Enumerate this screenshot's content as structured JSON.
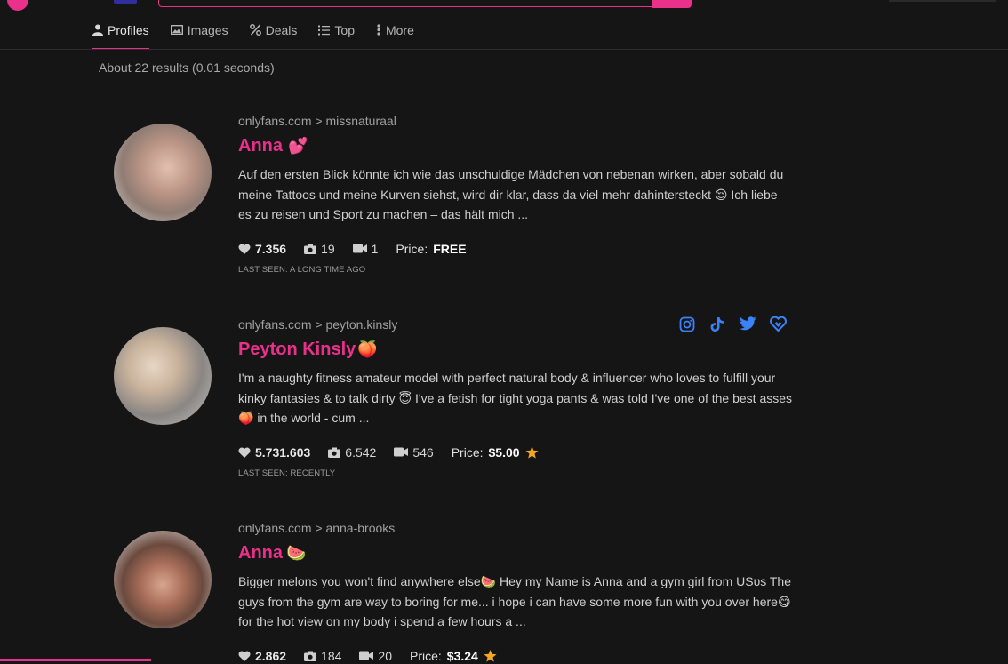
{
  "tabs": [
    {
      "label": "Profiles",
      "icon": "person-icon",
      "active": true
    },
    {
      "label": "Images",
      "icon": "image-icon"
    },
    {
      "label": "Deals",
      "icon": "percent-icon"
    },
    {
      "label": "Top",
      "icon": "list-icon"
    },
    {
      "label": "More",
      "icon": "vertical-dots-icon"
    }
  ],
  "results_info": "About 22 results (0.01 seconds)",
  "results": [
    {
      "breadcrumb": "onlyfans.com > missnaturaal",
      "name": "Anna",
      "name_emoji": "💕",
      "description": "Auf den ersten Blick könnte ich wie das unschuldige Mädchen von nebenan wirken, aber sobald du meine Tattoos und meine Kurven siehst, wird dir klar, dass da viel mehr dahintersteckt 😌 Ich liebe es zu reisen und Sport zu machen – das hält mich ...",
      "likes": "7.356",
      "photos": "19",
      "videos": "1",
      "price_label": "Price:",
      "price": "FREE",
      "last_seen": "LAST SEEN: A LONG TIME AGO"
    },
    {
      "breadcrumb": "onlyfans.com > peyton.kinsly",
      "name": "Peyton Kinsly",
      "name_emoji": "🍑",
      "description": "I'm a naughty fitness amateur model with perfect natural body & influencer who loves to fulfill your kinky fantasies & to talk dirty 😇 I've a fetish for tight yoga pants & was told I've one of the best asses🍑 in the world - cum ...",
      "likes": "5.731.603",
      "photos": "6.542",
      "videos": "546",
      "price_label": "Price:",
      "price": "$5.00",
      "last_seen": "LAST SEEN: RECENTLY",
      "socials": [
        "instagram-icon",
        "tiktok-icon",
        "twitter-icon",
        "heart-link-icon"
      ]
    },
    {
      "breadcrumb": "onlyfans.com > anna-brooks",
      "name": "Anna",
      "name_emoji": "🍉",
      "description": "Bigger melons you won't find anywhere else🍉 Hey my Name is Anna and a gym girl from USᴜs The guys from the gym are way to boring for me... i hope i can have some more fun with you over here😋 for the hot view on my body i spend a few hours a ...",
      "likes": "2.862",
      "photos": "184",
      "videos": "20",
      "price_label": "Price:",
      "price": "$3.24"
    }
  ],
  "colors": {
    "accent": "#e9308a",
    "social_blue": "#3b82f6",
    "star": "#f5a623",
    "background": "#151516"
  }
}
